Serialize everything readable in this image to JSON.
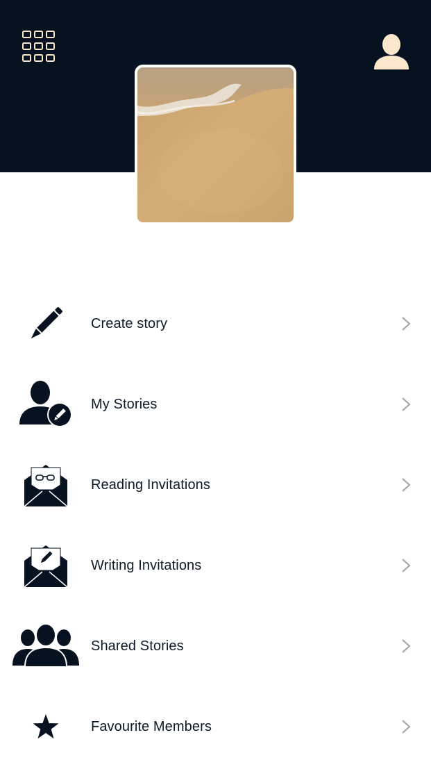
{
  "colors": {
    "header_bg": "#06121f",
    "icon_dark": "#06121f",
    "header_icon": "#fbe8cc",
    "chevron": "#a9a9ae",
    "text": "#0d1a28"
  },
  "header": {
    "menu_icon": "grid-icon",
    "profile_icon": "user-icon"
  },
  "cover_image": {
    "description_icon": "sand-beach-photo"
  },
  "menu": {
    "items": [
      {
        "label": "Create story",
        "icon": "pencil-icon"
      },
      {
        "label": "My Stories",
        "icon": "user-edit-icon"
      },
      {
        "label": "Reading Invitations",
        "icon": "envelope-glasses-icon"
      },
      {
        "label": "Writing Invitations",
        "icon": "envelope-pencil-icon"
      },
      {
        "label": "Shared Stories",
        "icon": "group-icon"
      },
      {
        "label": "Favourite Members",
        "icon": "star-icon"
      }
    ]
  }
}
